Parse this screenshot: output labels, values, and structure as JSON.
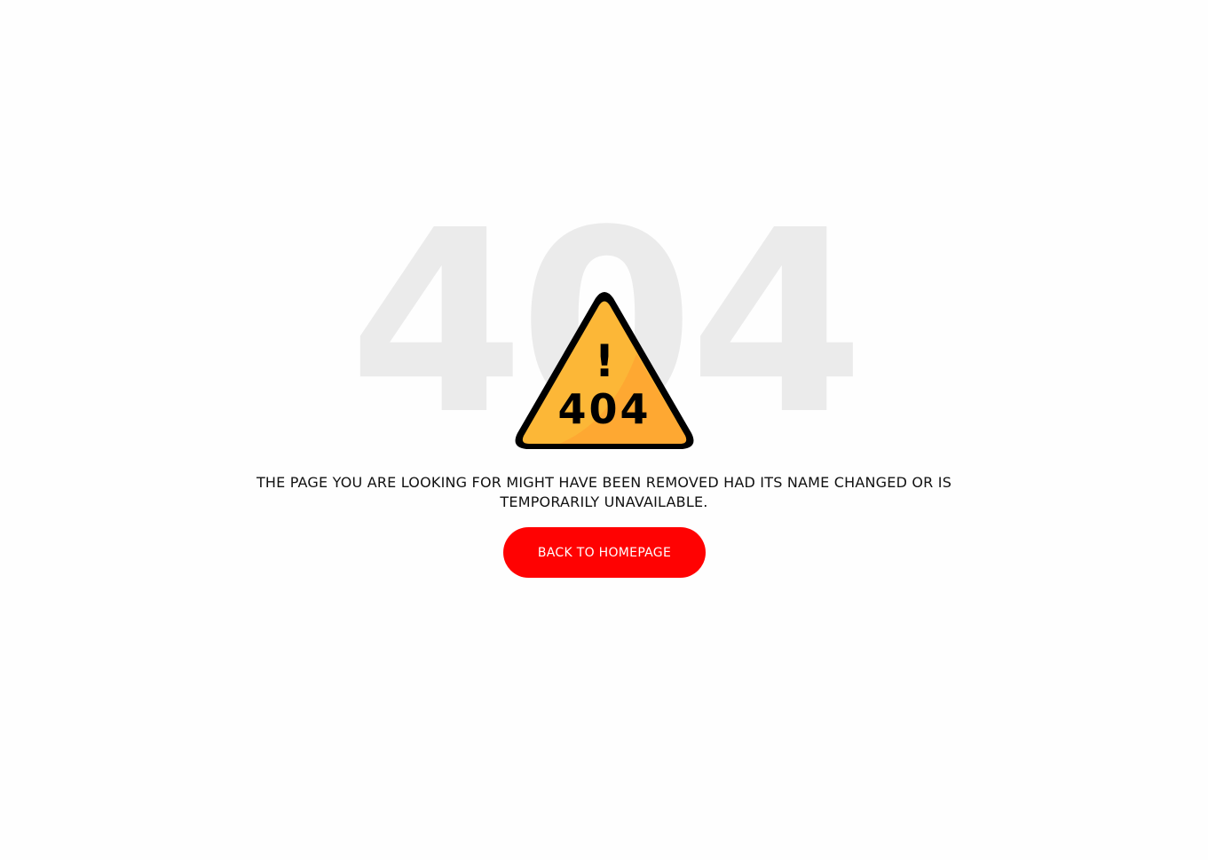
{
  "background_code": "404",
  "sign": {
    "exclamation": "!",
    "code": "404",
    "icon": "warning-triangle-icon",
    "colors": {
      "fill": "#fcb737",
      "shade": "#fea832",
      "outline": "#000000"
    }
  },
  "message": "THE PAGE YOU ARE LOOKING FOR MIGHT HAVE BEEN REMOVED HAD ITS NAME CHANGED OR IS TEMPORARILY UNAVAILABLE.",
  "button": {
    "label": "BACK TO HOMEPAGE",
    "color": "#ff0202"
  }
}
